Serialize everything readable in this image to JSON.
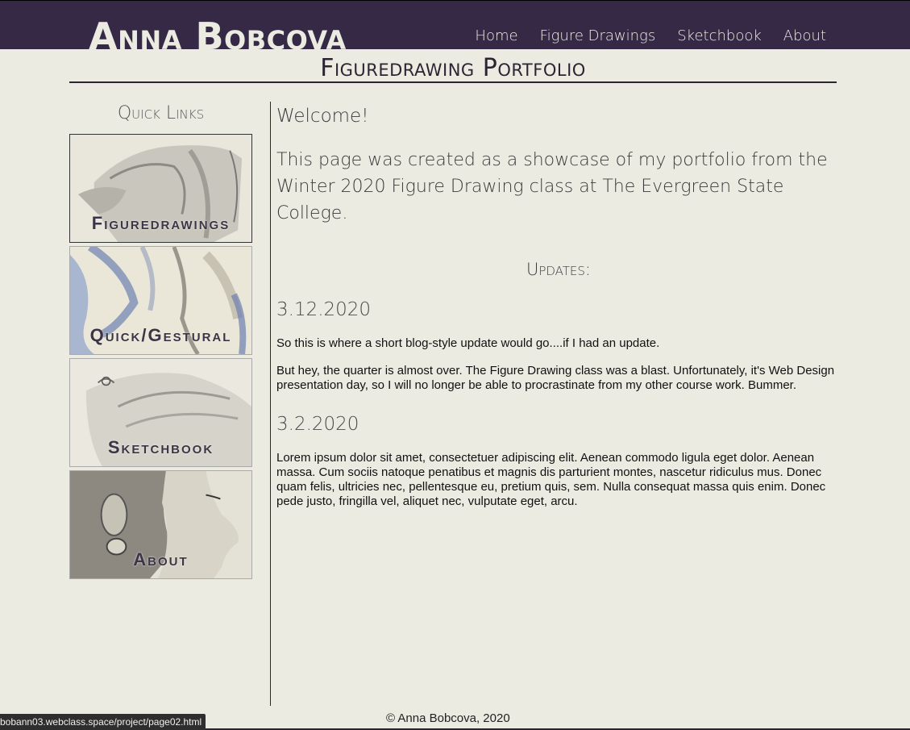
{
  "header": {
    "site_title": "Anna Bobcova",
    "nav": [
      "Home",
      "Figure Drawings",
      "Sketchbook",
      "About"
    ]
  },
  "page_title": "Figuredrawing Portfolio",
  "sidebar": {
    "title": "Quick Links",
    "links": [
      {
        "label": "Figuredrawings",
        "thumb": "figure-drawing-thumbnail"
      },
      {
        "label": "Quick/Gestural",
        "thumb": "gestural-drawing-thumbnail"
      },
      {
        "label": "Sketchbook",
        "thumb": "sketchbook-hand-thumbnail"
      },
      {
        "label": "About",
        "thumb": "portrait-profile-thumbnail"
      }
    ]
  },
  "main": {
    "welcome": "Welcome!",
    "intro": "This page was created as a showcase of my portfolio from the Winter 2020 Figure Drawing class at The Evergreen State College.",
    "updates_title": "Updates:",
    "posts": [
      {
        "date": "3.12.2020",
        "paragraphs": [
          "So this is where a short blog-style update would go....if I had an update.",
          "But hey, the quarter is almost over. The Figure Drawing class was a blast. Unfortunately, it's Web Design presentation day, so I will no longer be able to procrastinate from my other course work. Bummer."
        ]
      },
      {
        "date": "3.2.2020",
        "paragraphs": [
          "Lorem ipsum dolor sit amet, consectetuer adipiscing elit. Aenean commodo ligula eget dolor. Aenean massa. Cum sociis natoque penatibus et magnis dis parturient montes, nascetur ridiculus mus. Donec quam felis, ultricies nec, pellentesque eu, pretium quis, sem. Nulla consequat massa quis enim. Donec pede justo, fringilla vel, aliquet nec, vulputate eget, arcu."
        ]
      }
    ]
  },
  "footer": "© Anna Bobcova, 2020",
  "status_bar_url": "bobann03.webclass.space/project/page02.html",
  "colors": {
    "header_bg": "#352946",
    "page_bg": "#ecebe2",
    "accent_text": "#3c3548"
  }
}
